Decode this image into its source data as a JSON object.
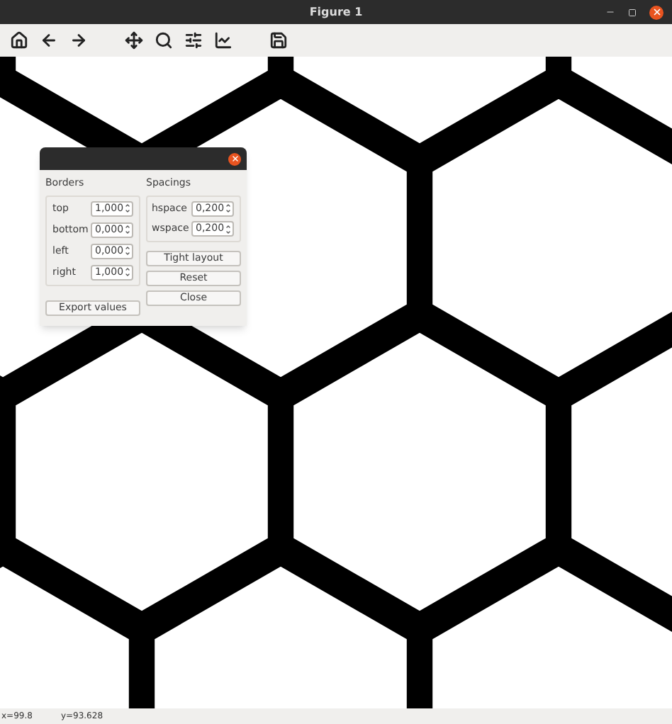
{
  "window": {
    "title": "Figure 1"
  },
  "toolbar": [
    {
      "kind": "home"
    },
    {
      "kind": "back"
    },
    {
      "kind": "forward"
    },
    {
      "kind": "separator"
    },
    {
      "kind": "pan"
    },
    {
      "kind": "zoom"
    },
    {
      "kind": "subplots"
    },
    {
      "kind": "axes"
    },
    {
      "kind": "separator"
    },
    {
      "kind": "save"
    }
  ],
  "dialog": {
    "borders": {
      "title": "Borders",
      "fields": [
        {
          "label": "top",
          "value": "1,000"
        },
        {
          "label": "bottom",
          "value": "0,000"
        },
        {
          "label": "left",
          "value": "0,000"
        },
        {
          "label": "right",
          "value": "1,000"
        }
      ]
    },
    "spacings": {
      "title": "Spacings",
      "fields": [
        {
          "label": "hspace",
          "value": "0,200"
        },
        {
          "label": "wspace",
          "value": "0,200"
        }
      ]
    },
    "buttons": [
      "Tight layout",
      "Reset"
    ],
    "export_button": "Export values",
    "close_button": "Close"
  },
  "status_bar": {
    "x": "x=99.8",
    "y": "y=93.628"
  }
}
